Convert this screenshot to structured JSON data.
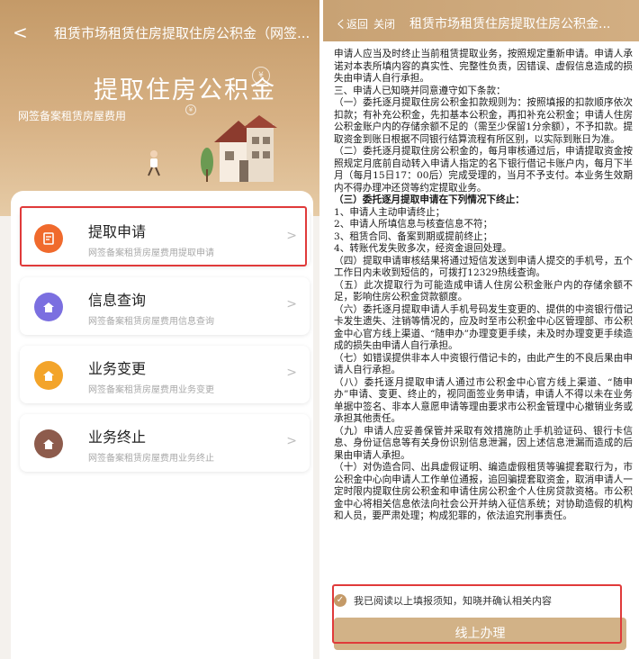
{
  "left": {
    "nav": {
      "back": "<",
      "title": "租赁市场租赁住房提取住房公积金（网签..."
    },
    "hero": {
      "title": "提取住房公积金",
      "subtitle": "网签备案租赁房屋费用"
    },
    "coins": [
      "¥",
      "¥"
    ],
    "menu": [
      {
        "label": "提取申请",
        "desc": "网签备案租赁房屋费用提取申请",
        "icon": "form-icon",
        "color": "#f06a2d"
      },
      {
        "label": "信息查询",
        "desc": "网签备案租赁房屋费用信息查询",
        "icon": "house-search-icon",
        "color": "#7b6fe0"
      },
      {
        "label": "业务变更",
        "desc": "网签备案租赁房屋费用业务变更",
        "icon": "house-change-icon",
        "color": "#f3a42a"
      },
      {
        "label": "业务终止",
        "desc": "网签备案租赁房屋费用业务终止",
        "icon": "house-stop-icon",
        "color": "#8d5b4c"
      }
    ],
    "chevron": ">"
  },
  "right": {
    "header": {
      "back": "く返回",
      "close": "关闭",
      "title": "租赁市场租赁住房提取住房公积金..."
    },
    "doc_lines": [
      {
        "text": "申请人应当及时终止当前租赁提取业务，按照规定重新申请。申请人承诺对本表所填内容的真实性、完整性负责，因错误、虚假信息造成的损失由申请人自行承担。",
        "bold": false
      },
      {
        "text": "三、申请人已知晓并同意遵守如下条款：",
        "bold": false
      },
      {
        "text": "（一）委托逐月提取住房公积金扣款规则为：按照填报的扣款顺序依次扣款；有补充公积金，先扣基本公积金，再扣补充公积金；申请人住房公积金账户内的存储余额不足的（需至少保留1分余额），不予扣款。提取资金到账日根据不同银行结算流程有所区别，以实际到账日为准。",
        "bold": false
      },
      {
        "text": "（二）委托逐月提取住房公积金的，每月审核通过后，申请提取资金按照规定月底前自动转入申请人指定的名下银行借记卡账户内，每月下半月（每月15日17：00后）完成受理的，当月不予支付。本业务生效期内不得办理冲还贷等约定提取业务。",
        "bold": false
      },
      {
        "text": "（三）委托逐月提取申请在下列情况下终止：",
        "bold": true
      },
      {
        "text": "1、申请人主动申请终止；",
        "bold": false
      },
      {
        "text": "2、申请人所填信息与核查信息不符；",
        "bold": false
      },
      {
        "text": "3、租赁合同、备案到期或提前终止；",
        "bold": false
      },
      {
        "text": "4、转账代发失败多次，经资金退回处理。",
        "bold": false
      },
      {
        "text": "（四）提取申请审核结果将通过短信发送到申请人提交的手机号，五个工作日内未收到短信的，可拨打12329热线查询。",
        "bold": false
      },
      {
        "text": "（五）此次提取行为可能造成申请人住房公积金账户内的存储余额不足，影响住房公积金贷款额度。",
        "bold": false
      },
      {
        "text": "（六）委托逐月提取申请人手机号码发生变更的、提供的中资银行借记卡发生遗失、注销等情况的，应及时至市公积金中心区管理部、市公积金中心官方线上渠道、“随申办”办理变更手续，未及时办理变更手续造成的损失由申请人自行承担。",
        "bold": false
      },
      {
        "text": "（七）如错误提供非本人中资银行借记卡的，由此产生的不良后果由申请人自行承担。",
        "bold": false
      },
      {
        "text": "（八）委托逐月提取申请人通过市公积金中心官方线上渠道、“随申办”申请、变更、终止的，视同面签业务申请，申请人不得以未在业务单据中签名、非本人意愿申请等理由要求市公积金管理中心撤销业务或承担其他责任。",
        "bold": false
      },
      {
        "text": "（九）申请人应妥善保管并采取有效措施防止手机验证码、银行卡信息、身份证信息等有关身份识别信息泄漏，因上述信息泄漏而造成的后果由申请人承担。",
        "bold": false
      },
      {
        "text": "（十）对伪造合同、出具虚假证明、编造虚假租赁等骗提套取行为，市公积金中心向申请人工作单位通报，追回骗提套取资金，取消申请人一定时限内提取住房公积金和申请住房公积金个人住房贷款资格。市公积金中心将相关信息依法向社会公开并纳入征信系统；对协助造假的机构和人员，要严肃处理；构成犯罪的，依法追究刑事责任。",
        "bold": false
      }
    ],
    "agree_text": "我已阅读以上填报须知，知晓并确认相关内容",
    "agree_check": "✓",
    "button": "线上办理"
  }
}
